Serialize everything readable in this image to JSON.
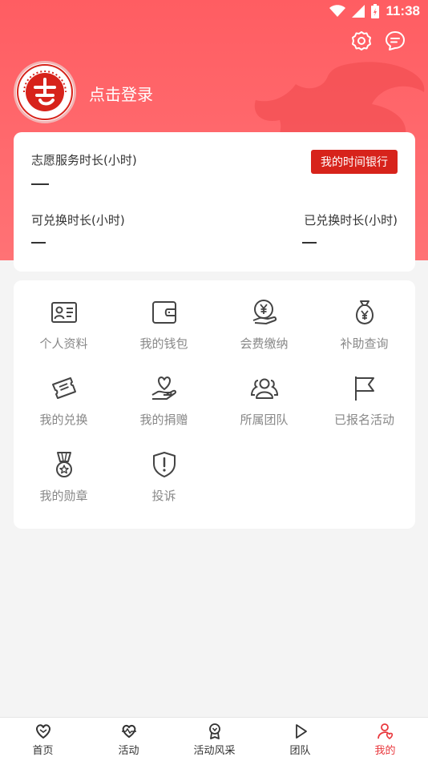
{
  "status_bar": {
    "time": "11:38"
  },
  "header": {
    "login_text": "点击登录"
  },
  "hours": {
    "service_label": "志愿服务时长(小时)",
    "service_value": "—",
    "bank_button": "我的时间银行",
    "exchangeable_label": "可兑换时长(小时)",
    "exchangeable_value": "—",
    "exchanged_label": "已兑换时长(小时)",
    "exchanged_value": "—"
  },
  "menu": {
    "items": [
      {
        "label": "个人资料",
        "icon": "id-card-icon"
      },
      {
        "label": "我的钱包",
        "icon": "wallet-icon"
      },
      {
        "label": "会费缴纳",
        "icon": "yen-hand-icon"
      },
      {
        "label": "补助查询",
        "icon": "money-bag-icon"
      },
      {
        "label": "我的兑换",
        "icon": "ticket-icon"
      },
      {
        "label": "我的捐赠",
        "icon": "heart-hand-icon"
      },
      {
        "label": "所属团队",
        "icon": "group-icon"
      },
      {
        "label": "已报名活动",
        "icon": "flag-icon"
      },
      {
        "label": "我的勋章",
        "icon": "medal-icon"
      },
      {
        "label": "投诉",
        "icon": "shield-alert-icon"
      }
    ]
  },
  "tabbar": {
    "tabs": [
      {
        "label": "首页",
        "icon": "home-heart-icon"
      },
      {
        "label": "活动",
        "icon": "activity-heart-icon"
      },
      {
        "label": "活动风采",
        "icon": "badge-icon"
      },
      {
        "label": "团队",
        "icon": "play-icon"
      },
      {
        "label": "我的",
        "icon": "profile-heart-icon"
      }
    ],
    "active_index": 4
  },
  "colors": {
    "brand": "#ff5d62",
    "accent": "#d7231b",
    "active_tab": "#e9383d"
  }
}
